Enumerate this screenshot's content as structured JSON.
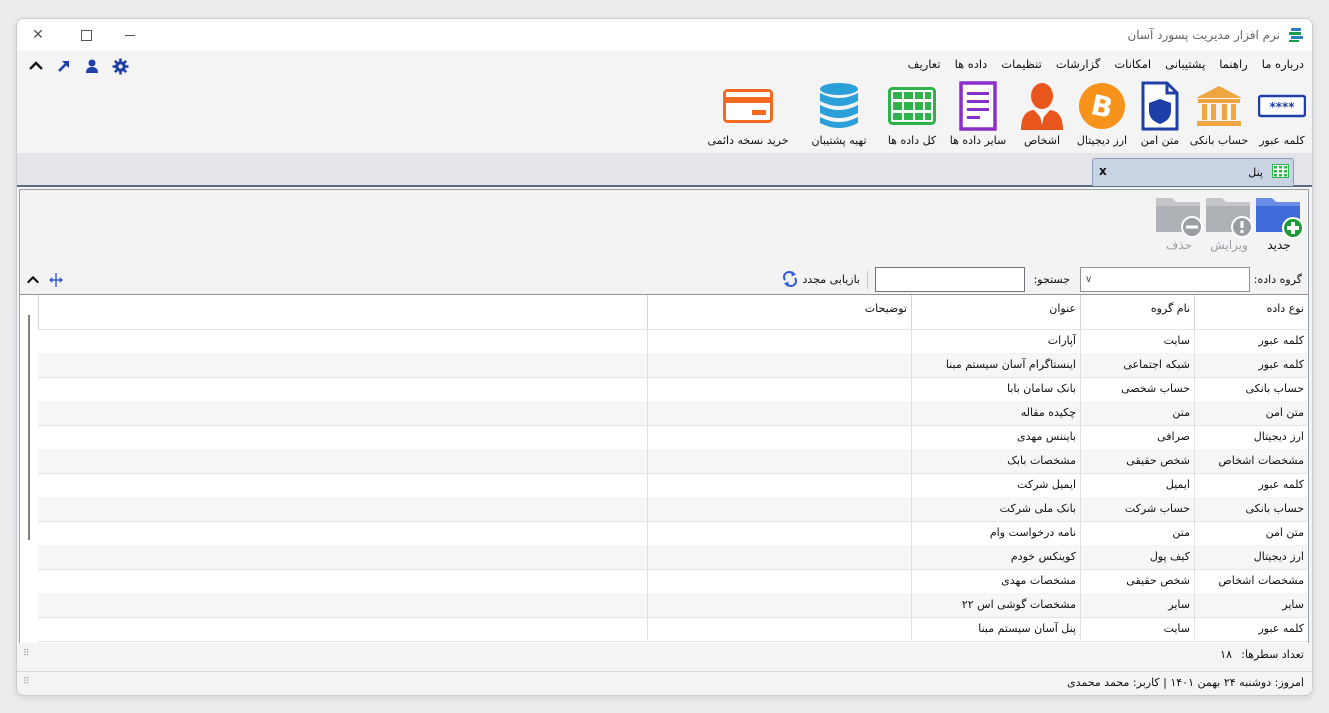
{
  "window": {
    "title": "نرم افزار مدیریت پسورد آسان"
  },
  "menu": {
    "items": [
      "تعاریف",
      "داده ها",
      "تنظیمات",
      "گزارشات",
      "امکانات",
      "پشتیبانی",
      "راهنما",
      "درباره ما"
    ]
  },
  "toolbar_icons": [
    "gear-icon",
    "user-icon",
    "arrow-up-right-icon",
    "chevron-up-icon"
  ],
  "ribbon": {
    "items": [
      {
        "label": "کلمه عبور",
        "icon": "password-icon"
      },
      {
        "label": "حساب بانکی",
        "icon": "bank-icon"
      },
      {
        "label": "متن امن",
        "icon": "secure-document-icon"
      },
      {
        "label": "ارز دیجیتال",
        "icon": "bitcoin-icon"
      },
      {
        "label": "اشخاص",
        "icon": "person-icon"
      },
      {
        "label": "سایر داده ها",
        "icon": "document-list-icon"
      },
      {
        "label": "کل داده ها",
        "icon": "grid-table-icon"
      },
      {
        "label": "تهیه پشتیبان",
        "icon": "database-icon"
      },
      {
        "label": "خرید نسخه دائمی",
        "icon": "credit-card-icon"
      }
    ]
  },
  "tab": {
    "label": "پنل",
    "close": "x"
  },
  "panel_toolbar": {
    "new_label": "جدید",
    "edit_label": "ویرایش",
    "delete_label": "حذف"
  },
  "filter": {
    "group_label": "گروه داده:",
    "group_value": "",
    "search_label": "جستجو:",
    "search_value": "",
    "reload_label": "بازیابی مجدد"
  },
  "table": {
    "columns": [
      "نوع داده",
      "نام گروه",
      "عنوان",
      "توضیحات",
      ""
    ],
    "rows": [
      [
        "کلمه عبور",
        "سایت",
        "آپارات",
        "",
        ""
      ],
      [
        "کلمه عبور",
        "شبکه اجتماعی",
        "اینستاگرام آسان سیستم مبنا",
        "",
        ""
      ],
      [
        "حساب بانکی",
        "حساب شخصی",
        "بانک سامان بابا",
        "",
        ""
      ],
      [
        "متن امن",
        "متن",
        "چکیده مقاله",
        "",
        ""
      ],
      [
        "ارز دیجیتال",
        "صرافی",
        "بایننس مهدی",
        "",
        ""
      ],
      [
        "مشخصات اشخاص",
        "شخص حقیقی",
        "مشخصات بابک",
        "",
        ""
      ],
      [
        "کلمه عبور",
        "ایمیل",
        "ایمیل شرکت",
        "",
        ""
      ],
      [
        "حساب بانکی",
        "حساب شرکت",
        "بانک ملی شرکت",
        "",
        ""
      ],
      [
        "متن امن",
        "متن",
        "نامه درخواست وام",
        "",
        ""
      ],
      [
        "ارز دیجیتال",
        "کیف پول",
        "کوینکس خودم",
        "",
        ""
      ],
      [
        "مشخصات اشخاص",
        "شخص حقیقی",
        "مشخصات مهدی",
        "",
        ""
      ],
      [
        "سایر",
        "سایر",
        "مشخصات گوشی اس ۲۲",
        "",
        ""
      ],
      [
        "کلمه عبور",
        "سایت",
        "پنل آسان سیستم مبنا",
        "",
        ""
      ]
    ]
  },
  "footer": {
    "row_count_label": "تعداد سطرها:",
    "row_count_value": "۱۸",
    "status_text": "امروز: دوشنبه ۲۴ بهمن ۱۴۰۱   |   کاربر: محمد محمدی"
  },
  "colors": {
    "accent_blue": "#1f3fa8",
    "bank_orange": "#f0a640",
    "bitcoin_orange": "#f7931a",
    "person_orange": "#e8561d",
    "doc_purple": "#8b2fc9",
    "grid_green": "#2db34a",
    "db_blue": "#2a9fd8",
    "card_orange": "#f26a22"
  }
}
